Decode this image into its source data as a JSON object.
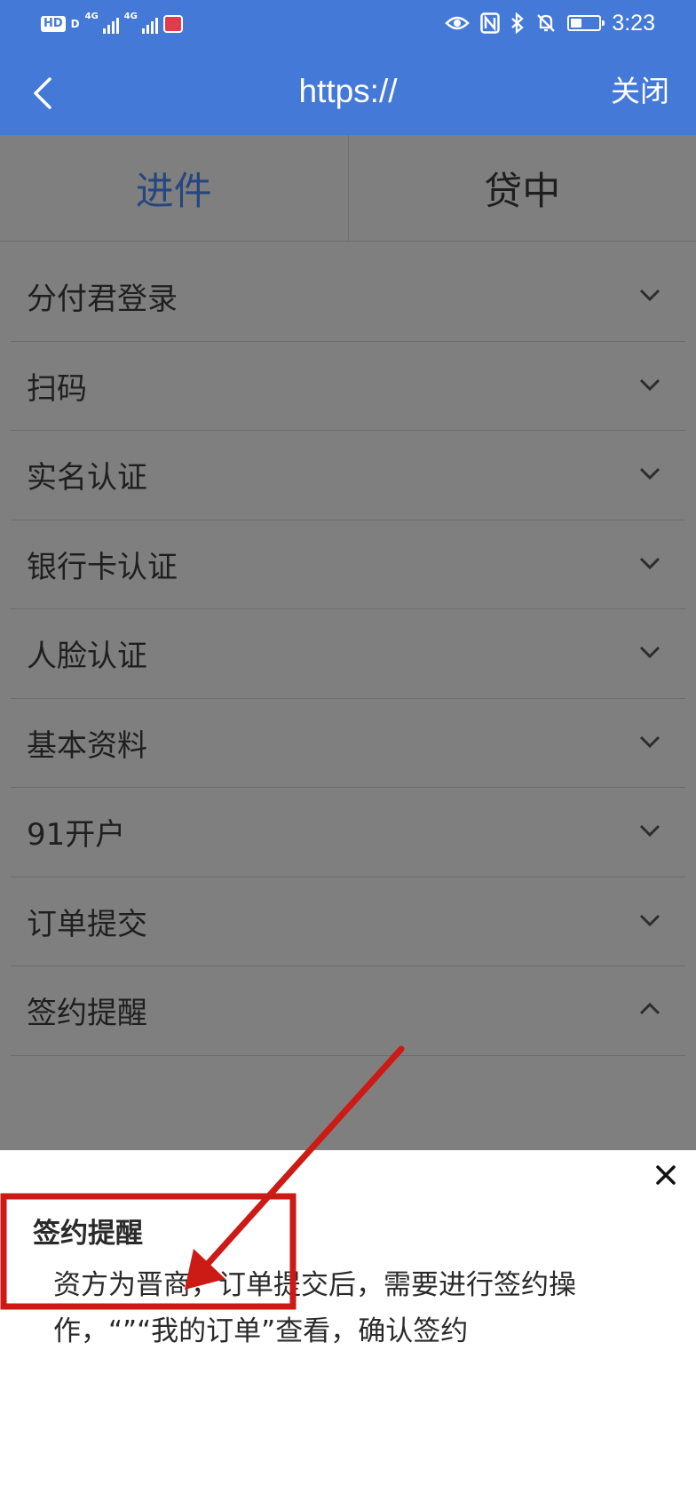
{
  "status_bar": {
    "time": "3:23",
    "hd_label": "HD",
    "sim1_label": "4G",
    "sim2_label": "4G",
    "battery_level": 0.4
  },
  "nav": {
    "title": "https://",
    "close_label": "关闭"
  },
  "tabs": [
    {
      "label": "进件",
      "active": true
    },
    {
      "label": "贷中",
      "active": false
    }
  ],
  "sections": [
    {
      "label": "分付君登录",
      "expanded": false
    },
    {
      "label": "扫码",
      "expanded": false
    },
    {
      "label": "实名认证",
      "expanded": false
    },
    {
      "label": "银行卡认证",
      "expanded": false
    },
    {
      "label": "人脸认证",
      "expanded": false
    },
    {
      "label": "基本资料",
      "expanded": false
    },
    {
      "label": "91开户",
      "expanded": false
    },
    {
      "label": "订单提交",
      "expanded": false
    },
    {
      "label": "签约提醒",
      "expanded": true
    }
  ],
  "sheet": {
    "title": "签约提醒",
    "body": "资方为晋商，订单提交后，需要进行签约操作，“”“我的订单”查看，确认签约"
  },
  "colors": {
    "accent": "#4479d8",
    "active_tab": "#26467f",
    "annotation": "#cc1a14"
  },
  "icons": [
    "back-arrow-icon",
    "chevron-down-icon",
    "chevron-up-icon",
    "close-icon",
    "eye-icon",
    "nfc-icon",
    "bluetooth-icon",
    "bell-off-icon",
    "battery-icon"
  ]
}
